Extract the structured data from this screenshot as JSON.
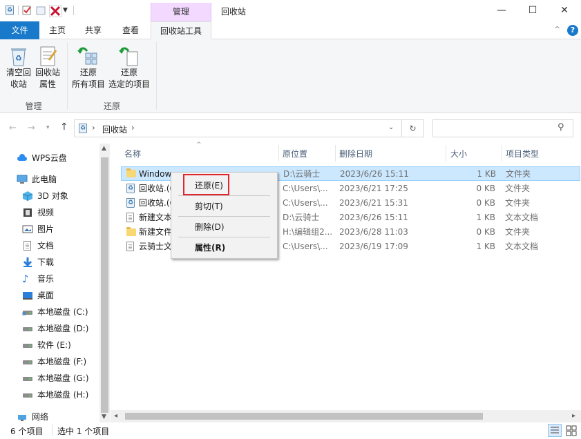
{
  "window": {
    "title": "回收站",
    "context_tab": "管理",
    "minimize": "—",
    "maximize": "☐",
    "close": "✕"
  },
  "ribbon_tabs": [
    "文件",
    "主页",
    "共享",
    "查看",
    "回收站工具"
  ],
  "ribbon": {
    "buttons": [
      {
        "line1": "清空回",
        "line2": "收站"
      },
      {
        "line1": "回收站",
        "line2": "属性"
      },
      {
        "line1": "还原",
        "line2": "所有项目"
      },
      {
        "line1": "还原",
        "line2": "选定的项目"
      }
    ],
    "groups": [
      "管理",
      "还原"
    ]
  },
  "address": {
    "path": "回收站",
    "separator": "›"
  },
  "search": {
    "placeholder": ""
  },
  "nav": {
    "items": [
      {
        "label": "WPS云盘",
        "icon": "cloud-icon"
      },
      {
        "label": "此电脑",
        "icon": "computer-icon"
      },
      {
        "label": "3D 对象",
        "icon": "3d-objects-icon"
      },
      {
        "label": "视频",
        "icon": "video-icon"
      },
      {
        "label": "图片",
        "icon": "pictures-icon"
      },
      {
        "label": "文档",
        "icon": "documents-icon"
      },
      {
        "label": "下载",
        "icon": "download-icon"
      },
      {
        "label": "音乐",
        "icon": "music-icon"
      },
      {
        "label": "桌面",
        "icon": "desktop-icon"
      },
      {
        "label": "本地磁盘 (C:)",
        "icon": "drive-icon"
      },
      {
        "label": "本地磁盘 (D:)",
        "icon": "drive-icon"
      },
      {
        "label": "软件 (E:)",
        "icon": "drive-icon"
      },
      {
        "label": "本地磁盘 (F:)",
        "icon": "drive-icon"
      },
      {
        "label": "本地磁盘 (G:)",
        "icon": "drive-icon"
      },
      {
        "label": "本地磁盘 (H:)",
        "icon": "drive-icon"
      },
      {
        "label": "网络",
        "icon": "network-icon"
      }
    ]
  },
  "columns": [
    "名称",
    "原位置",
    "删除日期",
    "大小",
    "项目类型"
  ],
  "files": [
    {
      "name": "Windows",
      "location": "D:\\云骑士",
      "date": "2023/6/26 15:11",
      "size": "1 KB",
      "type": "文件夹",
      "icon": "folder-icon"
    },
    {
      "name": "回收站.(6",
      "location": "C:\\Users\\...",
      "date": "2023/6/21 17:25",
      "size": "0 KB",
      "type": "文件夹",
      "icon": "recycle-icon"
    },
    {
      "name": "回收站.(6",
      "location": "C:\\Users\\...",
      "date": "2023/6/21 15:31",
      "size": "0 KB",
      "type": "文件夹",
      "icon": "recycle-icon"
    },
    {
      "name": "新建文本",
      "location": "D:\\云骑士",
      "date": "2023/6/26 15:11",
      "size": "1 KB",
      "type": "文本文档",
      "icon": "text-file-icon"
    },
    {
      "name": "新建文件",
      "location": "H:\\编辑组2...",
      "date": "2023/6/28 11:03",
      "size": "0 KB",
      "type": "文件夹",
      "icon": "folder-icon"
    },
    {
      "name": "云骑士文",
      "location": "C:\\Users\\...",
      "date": "2023/6/19 17:09",
      "size": "1 KB",
      "type": "文本文档",
      "icon": "text-file-icon"
    }
  ],
  "context_menu": {
    "items": [
      "还原(E)",
      "剪切(T)",
      "删除(D)",
      "属性(R)"
    ],
    "highlight_color": "#e0262c"
  },
  "status": {
    "count": "6 个项目",
    "selected": "选中 1 个项目"
  },
  "colors": {
    "file_tab": "#1979ca",
    "context_tab": "#f3d9ff",
    "selection": "#cce8ff"
  }
}
